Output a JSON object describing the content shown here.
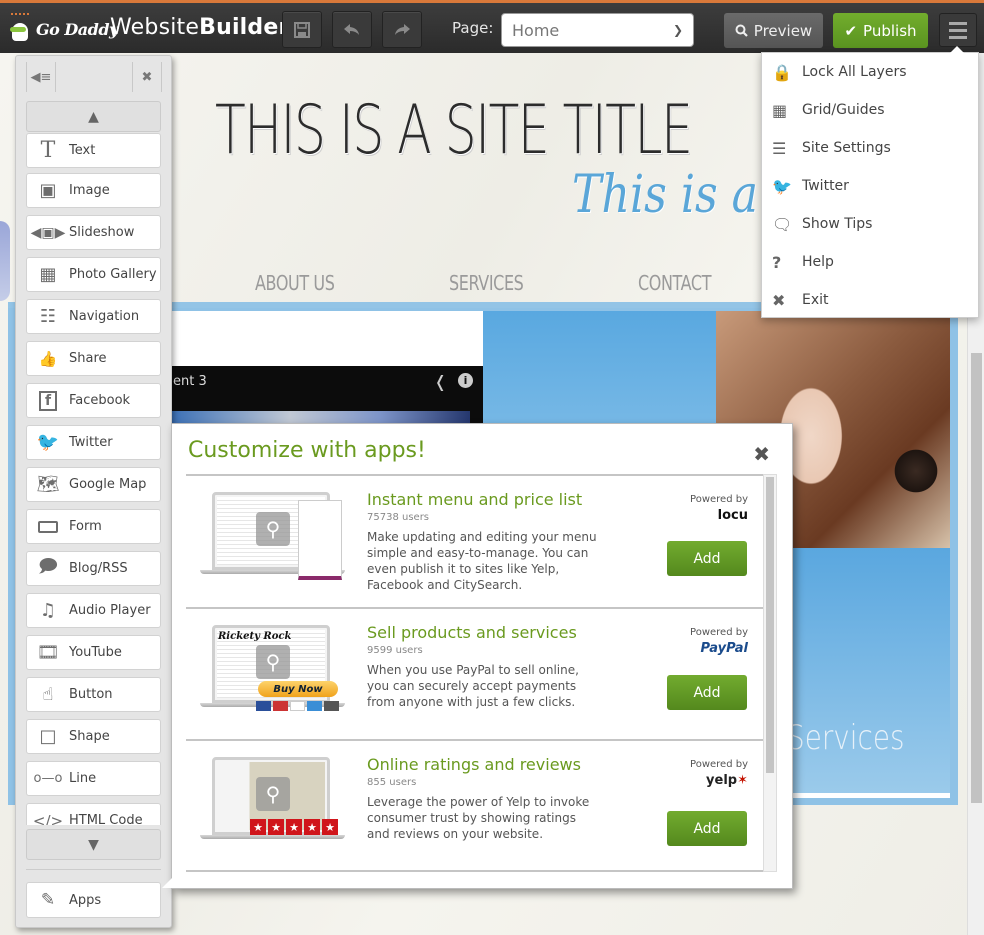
{
  "topbar": {
    "logo_text": "Go Daddy",
    "app_title_light": "Website",
    "app_title_bold": "Builder",
    "save_icon": "floppy-disk",
    "undo_icon": "undo-arrow",
    "redo_icon": "redo-arrow",
    "page_label": "Page:",
    "page_selected": "Home",
    "preview_label": "Preview",
    "publish_label": "Publish",
    "menu_icon": "hamburger",
    "accent_color": "#d9793a",
    "publish_color": "#66a126"
  },
  "menu": {
    "items": [
      {
        "icon": "lock",
        "label": "Lock All Layers"
      },
      {
        "icon": "grid",
        "label": "Grid/Guides"
      },
      {
        "icon": "sliders",
        "label": "Site Settings"
      },
      {
        "icon": "twitter-bird",
        "label": "Twitter"
      },
      {
        "icon": "speech-bubble",
        "label": "Show Tips"
      },
      {
        "icon": "question-mark",
        "label": "Help"
      },
      {
        "icon": "close-x",
        "label": "Exit"
      }
    ]
  },
  "toolbox": {
    "collapse_icon": "collapse-list",
    "pin_icon": "pushpin",
    "tools": [
      {
        "icon": "text-T",
        "label": "Text"
      },
      {
        "icon": "image",
        "label": "Image"
      },
      {
        "icon": "slideshow",
        "label": "Slideshow"
      },
      {
        "icon": "photo-gallery",
        "label": "Photo Gallery"
      },
      {
        "icon": "sitemap",
        "label": "Navigation"
      },
      {
        "icon": "thumbs-up-plus5",
        "label": "Share"
      },
      {
        "icon": "facebook-f",
        "label": "Facebook"
      },
      {
        "icon": "twitter-bird",
        "label": "Twitter"
      },
      {
        "icon": "map-pin",
        "label": "Google Map"
      },
      {
        "icon": "form-field",
        "label": "Form"
      },
      {
        "icon": "blog-bubble",
        "label": "Blog/RSS"
      },
      {
        "icon": "music-note",
        "label": "Audio Player"
      },
      {
        "icon": "film-strip",
        "label": "YouTube"
      },
      {
        "icon": "pointer-button",
        "label": "Button"
      },
      {
        "icon": "shape-square",
        "label": "Shape"
      },
      {
        "icon": "line-nodes",
        "label": "Line"
      },
      {
        "icon": "code-brackets",
        "label": "HTML Code"
      }
    ],
    "apps_label": "Apps",
    "apps_icon": "pencil-tools"
  },
  "site": {
    "title": "THIS IS A SITE TITLE",
    "tagline": "This is a",
    "nav": [
      "ABOUT US",
      "SERVICES",
      "CONTACT"
    ],
    "video_title": "ent 3",
    "services_heading": "Services"
  },
  "apps_dialog": {
    "title": "Customize with apps!",
    "close_icon": "close-x",
    "apps": [
      {
        "name": "Instant menu and price list",
        "users": "75738 users",
        "description": "Make updating and editing your menu simple and easy-to-manage. You can even publish it to sites like Yelp, Facebook and CitySearch.",
        "powered_by": "Powered by",
        "brand": "locu",
        "add_label": "Add"
      },
      {
        "name": "Sell products and services",
        "users": "9599 users",
        "description": "When you use PayPal to sell online, you can securely accept payments from anyone with just a few clicks.",
        "powered_by": "Powered by",
        "brand": "PayPal",
        "add_label": "Add",
        "thumb_button": "Buy Now",
        "thumb_store": "Rickety Rock"
      },
      {
        "name": "Online ratings and reviews",
        "users": "855 users",
        "description": "Leverage the power of Yelp to invoke consumer trust by showing ratings and reviews on your website.",
        "powered_by": "Powered by",
        "brand": "yelp",
        "add_label": "Add",
        "thumb_rating": 5
      }
    ]
  }
}
